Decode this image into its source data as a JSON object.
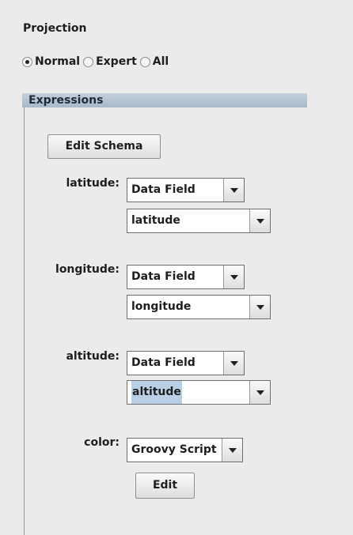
{
  "projection": {
    "title": "Projection",
    "modes": [
      {
        "label": "Normal",
        "selected": true
      },
      {
        "label": "Expert",
        "selected": false
      },
      {
        "label": "All",
        "selected": false
      }
    ]
  },
  "expressions": {
    "title": "Expressions",
    "edit_schema_label": "Edit Schema",
    "fields": [
      {
        "label": "latitude:",
        "type": "Data Field",
        "value": "latitude"
      },
      {
        "label": "longitude:",
        "type": "Data Field",
        "value": "longitude"
      },
      {
        "label": "altitude:",
        "type": "Data Field",
        "value": "altitude"
      }
    ],
    "color": {
      "label": "color:",
      "type": "Groovy Script",
      "edit_label": "Edit"
    }
  }
}
